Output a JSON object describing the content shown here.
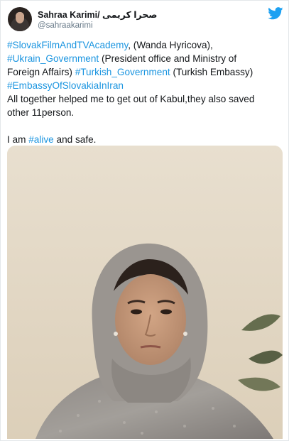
{
  "tweet": {
    "author": {
      "display_name": "Sahraa Karimi/ صحرا کریمی",
      "handle": "@sahraakarimi"
    },
    "text_lines": [
      [
        {
          "t": "#SlovakFilmAndTVAcademy",
          "tag": true
        },
        {
          "t": ", (Wanda Hyricova),",
          "tag": false
        }
      ],
      [
        {
          "t": " ",
          "tag": false
        },
        {
          "t": "#Ukrain_Government",
          "tag": true
        },
        {
          "t": " (President office and Ministry of",
          "tag": false
        }
      ],
      [
        {
          "t": "Foreign Affairs)   ",
          "tag": false
        },
        {
          "t": "#Turkish_Government",
          "tag": true
        },
        {
          "t": " (Turkish Embassy)",
          "tag": false
        }
      ],
      [
        {
          "t": "#EmbassyOfSlovakiaInIran",
          "tag": true
        }
      ],
      [
        {
          "t": "All together helped me to get out of Kabul,they also saved",
          "tag": false
        }
      ],
      [
        {
          "t": "other 11person.",
          "tag": false
        }
      ],
      [],
      [
        {
          "t": "I am ",
          "tag": false
        },
        {
          "t": "#alive",
          "tag": true
        },
        {
          "t": " and safe.",
          "tag": false
        }
      ]
    ]
  },
  "icons": {
    "brand": "twitter-bird-icon",
    "avatar": "avatar"
  },
  "colors": {
    "hashtag": "#1b95e0",
    "text": "#14171a",
    "secondary": "#657786",
    "brand": "#1da1f2"
  }
}
